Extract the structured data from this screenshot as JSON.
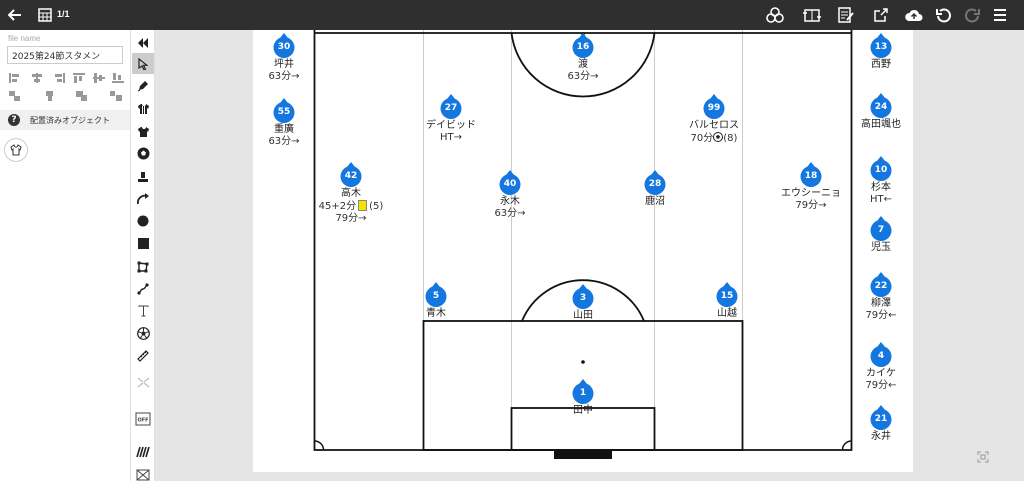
{
  "header": {
    "page_indicator": "1/1"
  },
  "left_panel": {
    "file_name_label": "file name",
    "file_name_value": "2025第24節スタメン",
    "placed_objects_label": "配置済みオブジェクト"
  },
  "colors": {
    "topbar": "#2f2f2f",
    "player": "#1477e0",
    "yellow_card": "#f6e400"
  },
  "pitch": {
    "players": [
      {
        "number": "16",
        "name": "渡",
        "note": "63分→"
      },
      {
        "number": "27",
        "name": "デイビッド",
        "note": "HT→"
      },
      {
        "number": "99",
        "name": "バルセロス",
        "note": "70分",
        "goal_count": "(8)"
      },
      {
        "number": "42",
        "name": "高木",
        "note_card": "45+2分",
        "card_count": "(5)",
        "note2": "79分→"
      },
      {
        "number": "40",
        "name": "永木",
        "note": "63分→"
      },
      {
        "number": "28",
        "name": "鹿沼",
        "note": ""
      },
      {
        "number": "18",
        "name": "エウシーニョ",
        "note": "79分→"
      },
      {
        "number": "5",
        "name": "青木",
        "note": ""
      },
      {
        "number": "3",
        "name": "山田",
        "note": ""
      },
      {
        "number": "15",
        "name": "山越",
        "note": ""
      },
      {
        "number": "1",
        "name": "田中",
        "note": ""
      }
    ],
    "bench_left": [
      {
        "number": "30",
        "name": "坪井",
        "note": "63分→"
      },
      {
        "number": "55",
        "name": "重廣",
        "note": "63分→"
      }
    ],
    "bench_right": [
      {
        "number": "13",
        "name": "西野",
        "note": ""
      },
      {
        "number": "24",
        "name": "高田颯也",
        "note": ""
      },
      {
        "number": "10",
        "name": "杉本",
        "note": "HT←"
      },
      {
        "number": "7",
        "name": "児玉",
        "note": ""
      },
      {
        "number": "22",
        "name": "柳澤",
        "note": "79分←"
      },
      {
        "number": "4",
        "name": "カイケ",
        "note": "79分←"
      },
      {
        "number": "21",
        "name": "永井",
        "note": ""
      }
    ]
  }
}
